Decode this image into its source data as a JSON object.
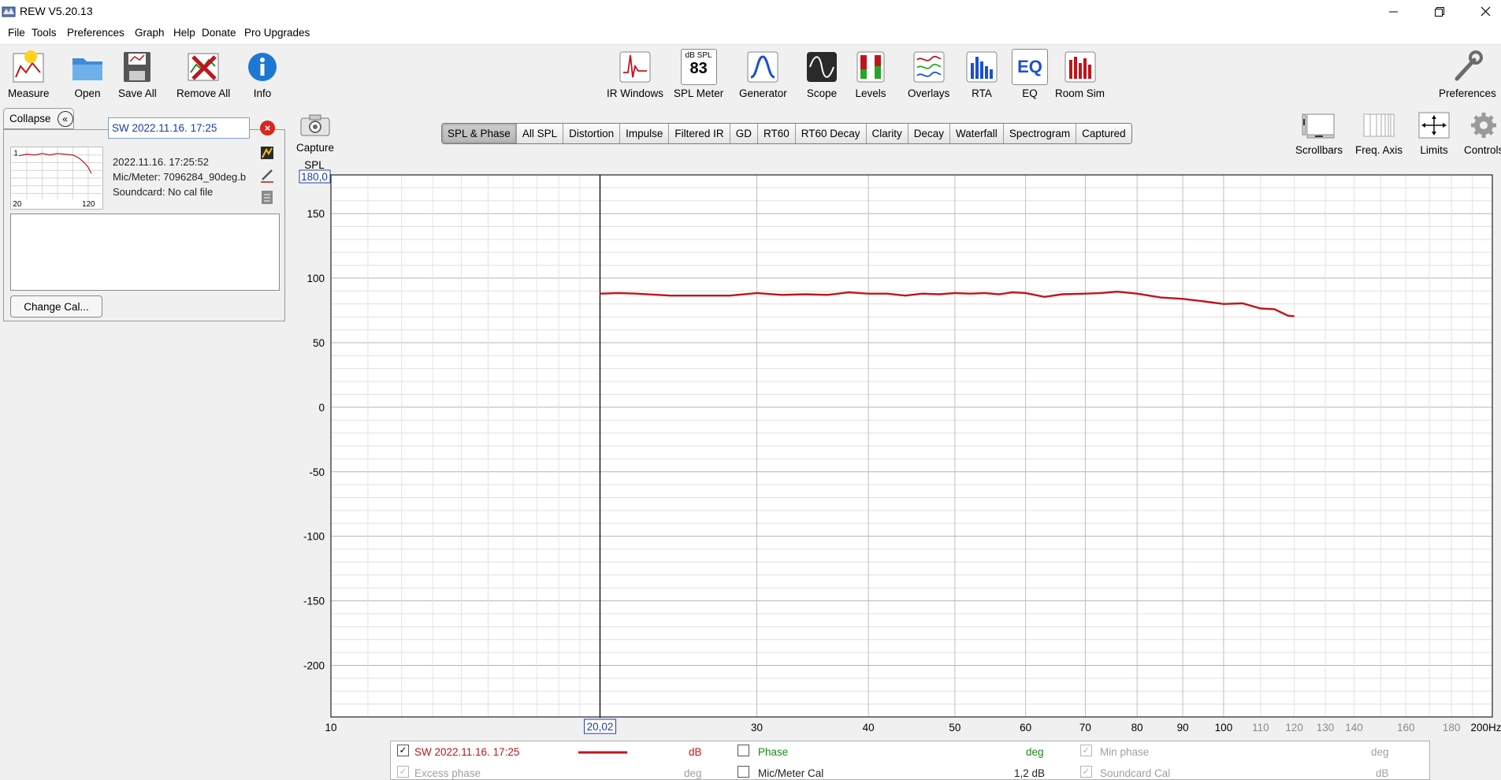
{
  "window": {
    "title": "REW V5.20.13"
  },
  "menu": [
    "File",
    "Tools",
    "Preferences",
    "Graph",
    "Help",
    "Donate",
    "Pro Upgrades"
  ],
  "toolbar": {
    "left": [
      {
        "label": "Measure",
        "icon": "measure-icon"
      },
      {
        "label": "Open",
        "icon": "folder-icon"
      },
      {
        "label": "Save All",
        "icon": "save-icon"
      },
      {
        "label": "Remove All",
        "icon": "remove-icon"
      },
      {
        "label": "Info",
        "icon": "info-icon"
      }
    ],
    "center": [
      {
        "label": "IR Windows",
        "icon": "ir-windows-icon"
      },
      {
        "label": "SPL Meter",
        "icon": "spl-meter-icon",
        "badge_top": "dB SPL",
        "badge_value": "83"
      },
      {
        "label": "Generator",
        "icon": "generator-icon"
      },
      {
        "label": "Scope",
        "icon": "scope-icon"
      },
      {
        "label": "Levels",
        "icon": "levels-icon"
      },
      {
        "label": "Overlays",
        "icon": "overlays-icon"
      },
      {
        "label": "RTA",
        "icon": "rta-icon"
      },
      {
        "label": "EQ",
        "icon": "eq-icon",
        "badge_value": "EQ"
      },
      {
        "label": "Room Sim",
        "icon": "room-sim-icon"
      }
    ],
    "right": {
      "label": "Preferences",
      "icon": "wrench-icon"
    }
  },
  "panel": {
    "collapse_label": "Collapse",
    "measurement_name": "SW 2022.11.16. 17:25",
    "thumb_x_min": "20",
    "thumb_x_max": "120",
    "thumb_index": "1",
    "info": [
      "2022.11.16. 17:25:52",
      "Mic/Meter: 7096284_90deg.b",
      "Soundcard: No cal file"
    ],
    "change_cal_label": "Change Cal..."
  },
  "capture_label": "Capture",
  "tabs": [
    "SPL & Phase",
    "All SPL",
    "Distortion",
    "Impulse",
    "Filtered IR",
    "GD",
    "RT60",
    "RT60 Decay",
    "Clarity",
    "Decay",
    "Waterfall",
    "Spectrogram",
    "Captured"
  ],
  "selected_tab": "SPL & Phase",
  "graph_controls": [
    {
      "label": "Scrollbars",
      "icon": "scrollbars-icon"
    },
    {
      "label": "Freq. Axis",
      "icon": "freq-axis-icon"
    },
    {
      "label": "Limits",
      "icon": "limits-icon"
    },
    {
      "label": "Controls",
      "icon": "gear-icon"
    }
  ],
  "chart_data": {
    "type": "line",
    "ylabel": "SPL",
    "y_top_readout": "180,0",
    "y_ticks": [
      150,
      100,
      50,
      0,
      -50,
      -100,
      -150,
      -200
    ],
    "y_tick_labels": [
      "150",
      "100",
      "50",
      "0",
      "-50",
      "-100",
      "-150",
      "-200"
    ],
    "ylim": [
      -240,
      180
    ],
    "x_scale": "log",
    "xlim": [
      10,
      200
    ],
    "x_ticks": [
      10,
      30,
      40,
      50,
      60,
      70,
      80,
      90,
      100,
      110,
      120,
      130,
      140,
      160,
      180
    ],
    "x_tick_labels": [
      "10",
      "30",
      "40",
      "50",
      "60",
      "70",
      "80",
      "90",
      "100",
      "110",
      "120",
      "130",
      "140",
      "160",
      "180"
    ],
    "x_end_label": "200Hz",
    "cursor_x": 20.02,
    "cursor_label": "20,02",
    "grid": true,
    "series": [
      {
        "name": "SW 2022.11.16. 17:25",
        "color": "#c0141c",
        "x": [
          20,
          21,
          22,
          24,
          26,
          28,
          30,
          32,
          34,
          36,
          38,
          40,
          42,
          44,
          46,
          48,
          50,
          52,
          54,
          56,
          58,
          60,
          63,
          66,
          70,
          73,
          76,
          80,
          85,
          90,
          95,
          100,
          105,
          110,
          114,
          116,
          118,
          120
        ],
        "values": [
          88,
          88.5,
          88,
          86.5,
          86.5,
          86.5,
          88.5,
          87,
          87.5,
          87,
          89,
          88,
          88,
          86.5,
          88,
          87.5,
          88.5,
          88,
          88.5,
          87.5,
          89,
          88.5,
          85.5,
          87.5,
          88,
          88.5,
          89.5,
          88,
          85,
          84,
          82,
          80,
          80.5,
          76.5,
          76,
          73.5,
          71,
          70.5
        ]
      }
    ]
  },
  "legend": {
    "row1": [
      {
        "label": "SW 2022.11.16. 17:25",
        "checked": true,
        "enabled": true,
        "unit": "dB",
        "color": "#c0141c"
      },
      {
        "label": "Phase",
        "checked": false,
        "enabled": true,
        "unit": "deg",
        "color": "#1a8a1a"
      },
      {
        "label": "Min phase",
        "checked": true,
        "enabled": false,
        "unit": "deg",
        "color": "#a0a0a0"
      }
    ],
    "row2": [
      {
        "label": "Excess phase",
        "checked": true,
        "enabled": false,
        "unit": "deg",
        "color": "#a0a0a0"
      },
      {
        "label": "Mic/Meter Cal",
        "checked": false,
        "enabled": true,
        "unit": "1,2 dB",
        "color": "#222222"
      },
      {
        "label": "Soundcard Cal",
        "checked": true,
        "enabled": false,
        "unit": "dB",
        "color": "#a0a0a0"
      }
    ]
  }
}
